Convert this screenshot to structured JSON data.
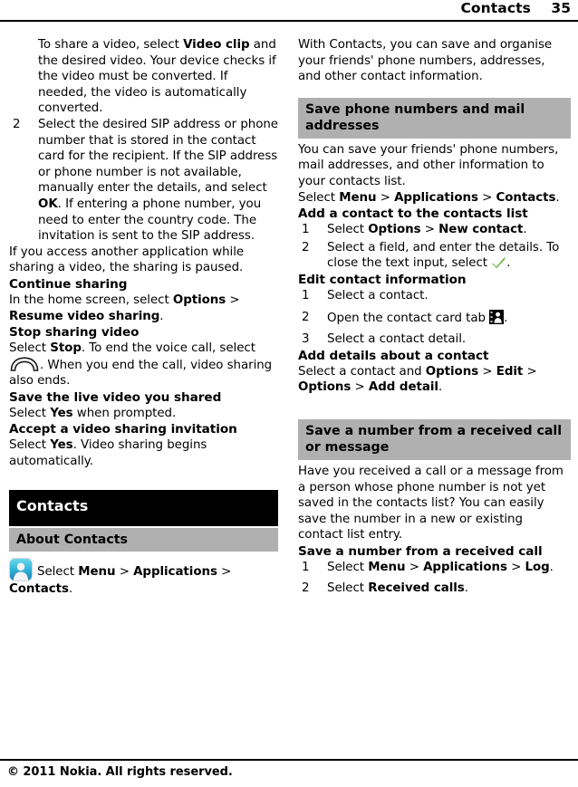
{
  "header": {
    "title": "Contacts",
    "page_number": "35"
  },
  "left_column": {
    "para_share_video": {
      "t1": "To share a video, select ",
      "b1": "Video clip",
      "t2": " and the desired video. Your device checks if the video must be converted. If needed, the video is automatically converted."
    },
    "list_item_2": {
      "num": "2",
      "t1": "Select the desired SIP address or phone number that is stored in the contact card for the recipient. If the SIP address or phone number is not available, manually enter the details, and select ",
      "b1": "OK",
      "t2": ". If entering a phone number, you need to enter the country code. The invitation is sent to the SIP address."
    },
    "para_paused": "If you access another application while sharing a video, the sharing is paused.",
    "head_continue_sharing": "Continue sharing",
    "para_continue_sharing": {
      "t1": "In the home screen, select ",
      "b1": "Options",
      "t2": " > ",
      "b2": "Resume video sharing",
      "t3": "."
    },
    "head_stop_sharing": "Stop sharing video",
    "para_stop_sharing": {
      "t1": "Select ",
      "b1": "Stop",
      "t2": ". To end the voice call, select ",
      "icon": "end-call-handset-icon",
      "t3": ". When you end the call, video sharing also ends."
    },
    "head_save_live_video": "Save the live video you shared",
    "para_save_live_video": {
      "t1": "Select ",
      "b1": "Yes",
      "t2": " when prompted."
    },
    "head_accept_invitation": "Accept a video sharing invitation",
    "para_accept_invitation": {
      "t1": "Select ",
      "b1": "Yes",
      "t2": ". Video sharing begins automatically."
    },
    "banner_contacts": "Contacts",
    "banner_about_contacts": "About Contacts",
    "para_about_contacts": {
      "icon": "contacts-app-icon",
      "t1": "Select ",
      "b1": "Menu",
      "t2": " > ",
      "b2": "Applications",
      "t3": " > ",
      "b3": "Contacts",
      "t4": "."
    }
  },
  "right_column": {
    "para_with_contacts": "With Contacts, you can save and organise your friends' phone numbers, addresses, and other contact information.",
    "banner_save_numbers": "Save phone numbers and mail addresses",
    "para_you_can_save": "You can save your friends' phone numbers, mail addresses, and other information to your contacts list.",
    "para_select_menu": {
      "t1": "Select ",
      "b1": "Menu",
      "t2": " > ",
      "b2": "Applications",
      "t3": " > ",
      "b3": "Contacts",
      "t4": "."
    },
    "head_add_contact": "Add a contact to the contacts list",
    "add_contact_steps": [
      {
        "num": "1",
        "t1": "Select ",
        "b1": "Options",
        "t2": " > ",
        "b2": "New contact",
        "t3": "."
      },
      {
        "num": "2",
        "t1": "Select a field, and enter the details. To close the text input, select ",
        "icon": "green-check-icon",
        "t2": "."
      }
    ],
    "head_edit_contact": "Edit contact information",
    "edit_contact_steps": [
      {
        "num": "1",
        "t1": "Select a contact."
      },
      {
        "num": "2",
        "t1": "Open the contact card tab ",
        "icon": "contact-card-tab-icon",
        "t2": "."
      },
      {
        "num": "3",
        "t1": "Select a contact detail."
      }
    ],
    "head_add_details": "Add details about a contact",
    "para_add_details": {
      "t1": "Select a contact and ",
      "b1": "Options",
      "t2": " > ",
      "b2": "Edit",
      "t3": " > ",
      "b3": "Options",
      "t4": " > ",
      "b4": "Add detail",
      "t5": "."
    },
    "banner_save_received": "Save a number from a received call or message",
    "para_have_you_received": "Have you received a call or a message from a person whose phone number is not yet saved in the contacts list? You can easily save the number in a new or existing contact list entry.",
    "head_save_received_call": "Save a number from a received call",
    "save_received_steps": [
      {
        "num": "1",
        "t1": "Select ",
        "b1": "Menu",
        "t2": " > ",
        "b2": "Applications",
        "t3": " > ",
        "b3": "Log",
        "t4": "."
      },
      {
        "num": "2",
        "t1": "Select ",
        "b1": "Received calls",
        "t2": "."
      }
    ]
  },
  "footer": {
    "copyright": "© 2011 Nokia. All rights reserved."
  },
  "colors": {
    "banner_black_bg": "#000000",
    "banner_gray_bg": "#b0b0b0",
    "check_green": "#6aaf3c",
    "avatar_blue": "#38b6d6",
    "text": "#000000",
    "page_bg": "#ffffff"
  }
}
